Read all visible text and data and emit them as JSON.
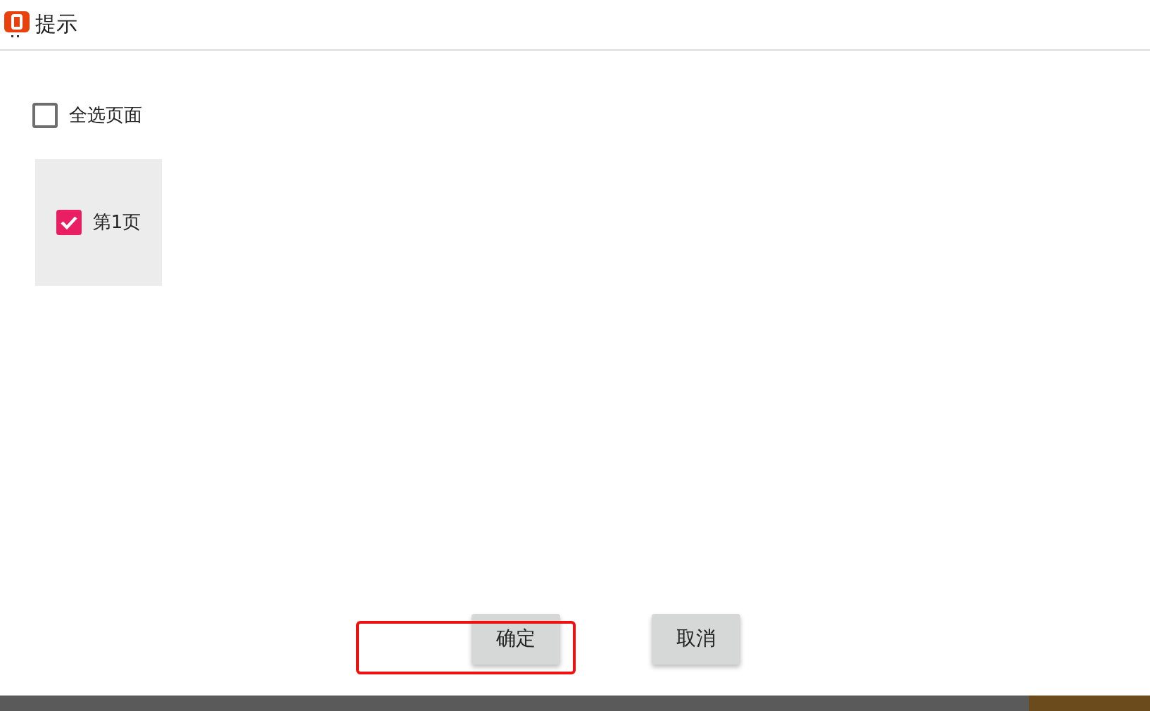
{
  "window": {
    "title": "提示"
  },
  "select_all": {
    "label": "全选页面",
    "checked": false
  },
  "pages": [
    {
      "label": "第1页",
      "checked": true
    }
  ],
  "buttons": [
    {
      "label": "确定"
    },
    {
      "label": "取消"
    }
  ]
}
